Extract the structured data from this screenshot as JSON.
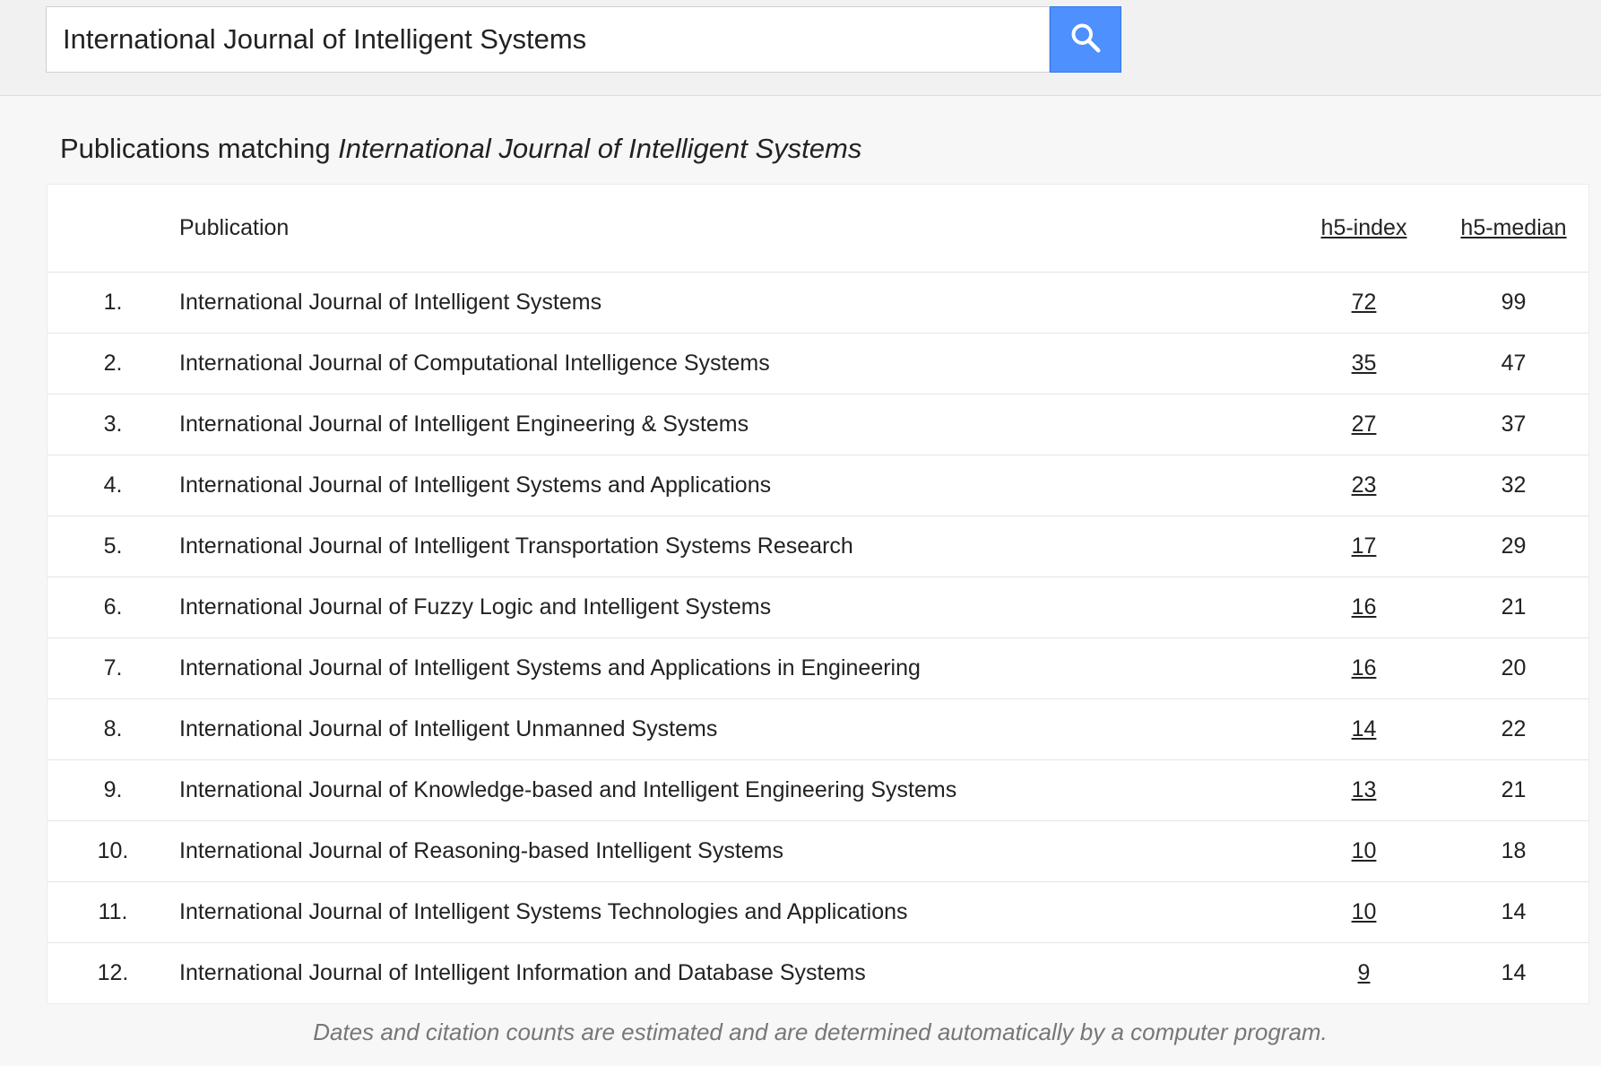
{
  "search": {
    "value": "International Journal of Intelligent Systems"
  },
  "heading": {
    "prefix": "Publications matching ",
    "query": "International Journal of Intelligent Systems"
  },
  "table": {
    "headers": {
      "publication": "Publication",
      "h5_index": "h5-index",
      "h5_median": "h5-median"
    },
    "rows": [
      {
        "rank": "1.",
        "title": "International Journal of Intelligent Systems",
        "h5_index": "72",
        "h5_median": "99"
      },
      {
        "rank": "2.",
        "title": "International Journal of Computational Intelligence Systems",
        "h5_index": "35",
        "h5_median": "47"
      },
      {
        "rank": "3.",
        "title": "International Journal of Intelligent Engineering & Systems",
        "h5_index": "27",
        "h5_median": "37"
      },
      {
        "rank": "4.",
        "title": "International Journal of Intelligent Systems and Applications",
        "h5_index": "23",
        "h5_median": "32"
      },
      {
        "rank": "5.",
        "title": "International Journal of Intelligent Transportation Systems Research",
        "h5_index": "17",
        "h5_median": "29"
      },
      {
        "rank": "6.",
        "title": "International Journal of Fuzzy Logic and Intelligent Systems",
        "h5_index": "16",
        "h5_median": "21"
      },
      {
        "rank": "7.",
        "title": "International Journal of Intelligent Systems and Applications in Engineering",
        "h5_index": "16",
        "h5_median": "20"
      },
      {
        "rank": "8.",
        "title": "International Journal of Intelligent Unmanned Systems",
        "h5_index": "14",
        "h5_median": "22"
      },
      {
        "rank": "9.",
        "title": "International Journal of Knowledge-based and Intelligent Engineering Systems",
        "h5_index": "13",
        "h5_median": "21"
      },
      {
        "rank": "10.",
        "title": "International Journal of Reasoning-based Intelligent Systems",
        "h5_index": "10",
        "h5_median": "18"
      },
      {
        "rank": "11.",
        "title": "International Journal of Intelligent Systems Technologies and Applications",
        "h5_index": "10",
        "h5_median": "14"
      },
      {
        "rank": "12.",
        "title": "International Journal of Intelligent Information and Database Systems",
        "h5_index": "9",
        "h5_median": "14"
      }
    ]
  },
  "footer": {
    "note": "Dates and citation counts are estimated and are determined automatically by a computer program."
  },
  "colors": {
    "accent": "#4d90fe"
  },
  "icons": {
    "search": "search-icon"
  }
}
